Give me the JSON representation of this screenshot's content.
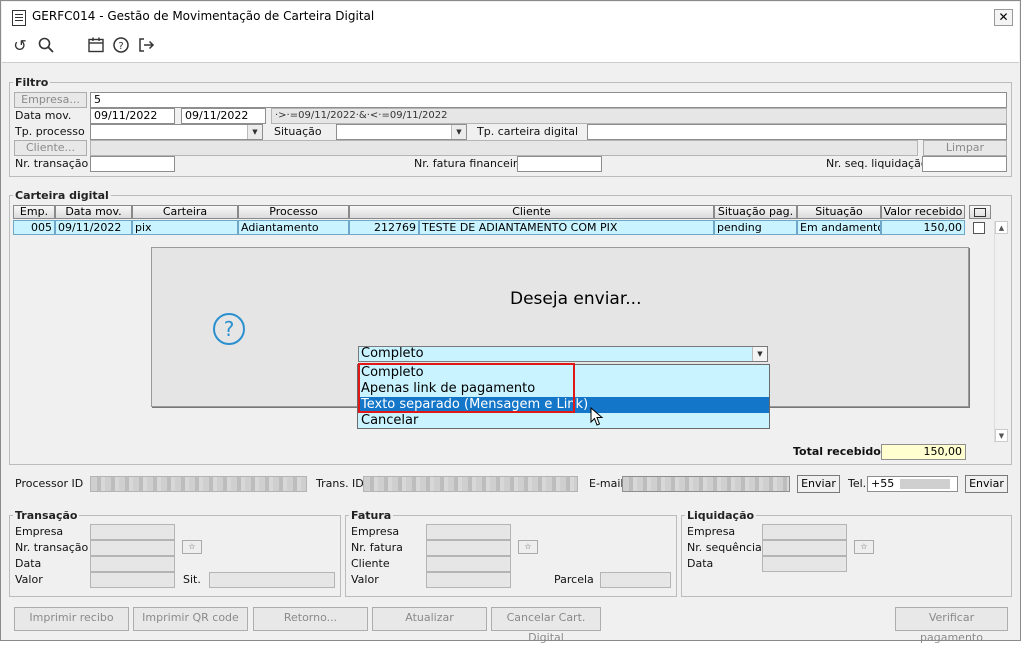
{
  "window": {
    "title": "GERFC014 - Gestão de Movimentação de Carteira Digital",
    "close": "✕"
  },
  "toolbar": {
    "icons": [
      "refresh-icon",
      "search-icon",
      "calendar-icon",
      "help-icon",
      "exit-icon"
    ]
  },
  "filtro": {
    "title": "Filtro",
    "empresa_btn": "Empresa...",
    "empresa_value": "5",
    "data_mov_label": "Data mov.",
    "data_mov_from": "09/11/2022",
    "data_mov_to": "09/11/2022",
    "data_mov_expr": "·>·=09/11/2022·&·<·=09/11/2022",
    "tp_processo_label": "Tp. processo",
    "tp_processo_value": "",
    "situacao_label": "Situação",
    "situacao_value": "",
    "tp_carteira_label": "Tp. carteira digital",
    "tp_carteira_value": "",
    "cliente_btn": "Cliente...",
    "limpar_btn": "Limpar",
    "nr_transacao_label": "Nr. transação",
    "nr_fatura_label": "Nr. fatura financeiro",
    "nr_seq_liq_label": "Nr. seq. liquidação"
  },
  "carteira": {
    "title": "Carteira digital",
    "columns": [
      "Emp.",
      "Data mov.",
      "Carteira",
      "Processo",
      "Cliente",
      "Situação pag.",
      "Situação",
      "Valor recebido"
    ],
    "row": {
      "emp": "005",
      "data_mov": "09/11/2022",
      "carteira": "pix",
      "processo": "Adiantamento",
      "cliente_cod": "212769",
      "cliente_nome": "TESTE DE ADIANTAMENTO COM PIX",
      "situacao_pag": "pending",
      "situacao": "Em andamento",
      "valor": "150,00"
    },
    "total_label": "Total recebido",
    "total_value": "150,00"
  },
  "dialog": {
    "message": "Deseja enviar...",
    "selected": "Completo",
    "options": [
      "Completo",
      "Apenas link de pagamento",
      "Texto separado (Mensagem e Link)",
      "Cancelar"
    ]
  },
  "info": {
    "processor_label": "Processor ID",
    "trans_label": "Trans. ID",
    "email_label": "E-mail",
    "enviar1": "Enviar",
    "tel_label": "Tel.",
    "tel_prefix": "+55",
    "enviar2": "Enviar"
  },
  "transacao": {
    "title": "Transação",
    "empresa": "Empresa",
    "nr_transacao": "Nr. transação",
    "data": "Data",
    "valor": "Valor",
    "sit": "Sit."
  },
  "fatura": {
    "title": "Fatura",
    "empresa": "Empresa",
    "nr_fatura": "Nr. fatura",
    "cliente": "Cliente",
    "valor": "Valor",
    "parcela": "Parcela"
  },
  "liquidacao": {
    "title": "Liquidação",
    "empresa": "Empresa",
    "nr_sequencia": "Nr. sequência",
    "data": "Data"
  },
  "buttons": {
    "imprimir_recibo": "Imprimir recibo",
    "imprimir_qr": "Imprimir QR code",
    "retorno": "Retorno...",
    "atualizar": "Atualizar",
    "cancelar_cart": "Cancelar Cart. Digital",
    "verificar": "Verificar pagamento"
  }
}
